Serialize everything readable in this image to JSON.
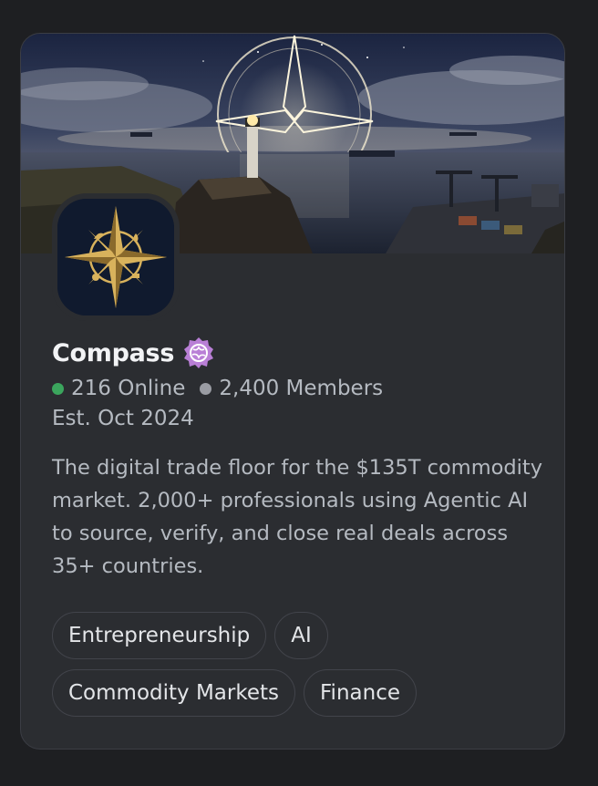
{
  "server": {
    "name": "Compass",
    "online_count": "216 Online",
    "member_count": "2,400 Members",
    "established": "Est. Oct 2024",
    "description": "The digital trade floor for the $135T commodity market. 2,000+ professionals using Agentic AI to source, verify, and close real deals across 35+ countries.",
    "verified_badge_icon": "discoverable-globe-badge-icon",
    "banner_image": "lighthouse-compass-harbor-night-banner",
    "server_icon": "gold-compass-rose-icon"
  },
  "tags": {
    "row1": [
      "Entrepreneurship",
      "AI"
    ],
    "row2": [
      "Commodity Markets",
      "Finance"
    ]
  },
  "colors": {
    "card_background": "#2b2d31",
    "page_background": "#1e1f22",
    "online_dot": "#3ba55d",
    "members_dot": "#9a9ca3",
    "badge": "#b97fd6",
    "compass_gold": "#d8b25c",
    "icon_background": "#101a2e"
  }
}
